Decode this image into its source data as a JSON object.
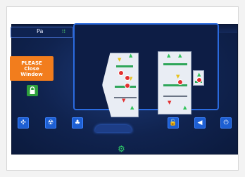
{
  "status": {
    "pressure_unit": "Pa",
    "pressure_indicator": "⁞⁞"
  },
  "alert": {
    "line1": "PLEASE",
    "line2": "Close",
    "line3": "Window"
  },
  "icons": {
    "lock": "🔒",
    "fan": "✣",
    "uv": "☢",
    "light": "♣",
    "unlock": "🔓",
    "sound": "◀",
    "power": "⏻",
    "settings": "⚙"
  },
  "colors": {
    "accent": "#2b6bdf",
    "warning": "#f27d1d",
    "ok": "#2e9f3c",
    "airflow_good": "#31c45b",
    "airflow_warn": "#e7c21e",
    "airflow_bad": "#e33232"
  }
}
